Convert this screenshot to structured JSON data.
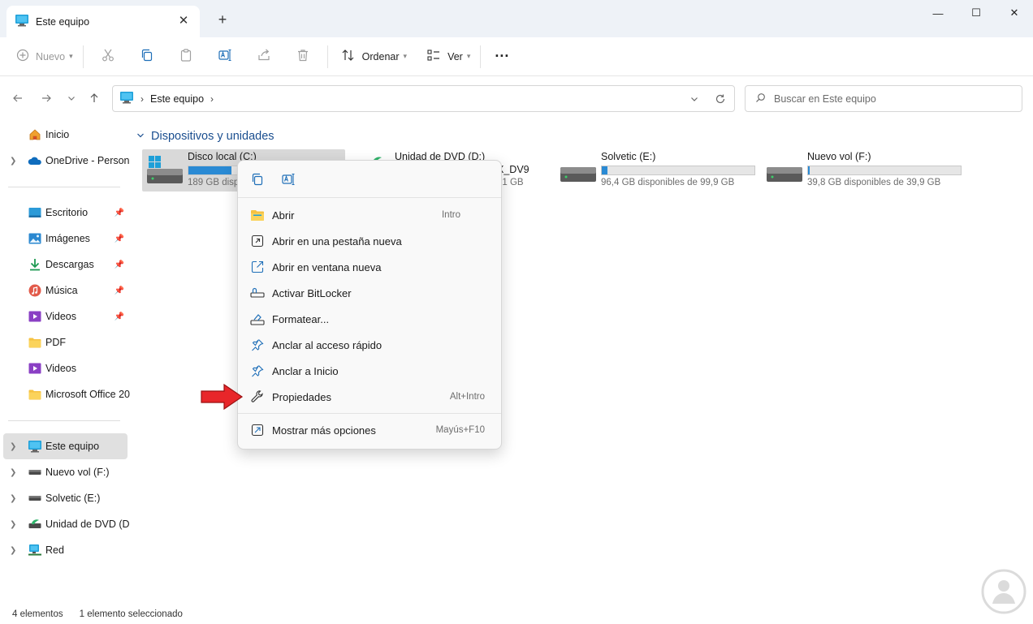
{
  "window": {
    "tab_title": "Este equipo",
    "tab_close": "✕",
    "new_tab": "+",
    "minimize": "—",
    "maximize": "☐",
    "close": "✕"
  },
  "toolbar": {
    "new_label": "Nuevo",
    "sort_label": "Ordenar",
    "view_label": "Ver",
    "more": "···",
    "icons": [
      "cut-icon",
      "copy-icon",
      "paste-icon",
      "rename-icon",
      "share-icon",
      "delete-icon"
    ]
  },
  "address": {
    "location": "Este equipo",
    "separator": "›",
    "search_placeholder": "Buscar en Este equipo"
  },
  "sidebar": {
    "items": [
      {
        "label": "Inicio",
        "icon": "home-icon"
      },
      {
        "label": "OneDrive - Persona",
        "icon": "onedrive-icon"
      },
      {
        "label": "Escritorio",
        "icon": "desktop-icon"
      },
      {
        "label": "Imágenes",
        "icon": "pictures-icon"
      },
      {
        "label": "Descargas",
        "icon": "downloads-icon"
      },
      {
        "label": "Música",
        "icon": "music-icon"
      },
      {
        "label": "Videos",
        "icon": "videos-icon"
      },
      {
        "label": "PDF",
        "icon": "folder-icon"
      },
      {
        "label": "Videos",
        "icon": "videos-icon"
      },
      {
        "label": "Microsoft Office 20",
        "icon": "folder-icon"
      },
      {
        "label": "Este equipo",
        "icon": "pc-icon"
      },
      {
        "label": "Nuevo vol (F:)",
        "icon": "drive-icon"
      },
      {
        "label": "Solvetic (E:)",
        "icon": "drive-icon"
      },
      {
        "label": "Unidad de DVD (D:)",
        "icon": "dvd-icon"
      },
      {
        "label": "Red",
        "icon": "network-icon"
      }
    ]
  },
  "main": {
    "group_title": "Dispositivos y unidades",
    "drives": [
      {
        "name": "Disco local (C:)",
        "space": "189 GB disp",
        "used_fraction": 0.28
      },
      {
        "name": "Unidad de DVD (D:)",
        "label_fragment": "X_DV9",
        "space": "91 GB"
      },
      {
        "name": "Solvetic (E:)",
        "space": "96,4 GB disponibles de 99,9 GB",
        "used_fraction": 0.035
      },
      {
        "name": "Nuevo vol (F:)",
        "space": "39,8 GB disponibles de 39,9 GB",
        "used_fraction": 0.003
      }
    ]
  },
  "context_menu": {
    "top_icons": [
      "copy-icon",
      "rename-icon"
    ],
    "items": [
      {
        "label": "Abrir",
        "shortcut": "Intro",
        "icon": "open-folder-icon"
      },
      {
        "label": "Abrir en una pestaña nueva",
        "shortcut": "",
        "icon": "new-tab-icon"
      },
      {
        "label": "Abrir en ventana nueva",
        "shortcut": "",
        "icon": "new-window-icon"
      },
      {
        "label": "Activar BitLocker",
        "shortcut": "",
        "icon": "bitlocker-icon"
      },
      {
        "label": "Formatear...",
        "shortcut": "",
        "icon": "format-icon"
      },
      {
        "label": "Anclar al acceso rápido",
        "shortcut": "",
        "icon": "pin-icon"
      },
      {
        "label": "Anclar a Inicio",
        "shortcut": "",
        "icon": "pin-icon"
      },
      {
        "label": "Propiedades",
        "shortcut": "Alt+Intro",
        "icon": "wrench-icon"
      }
    ],
    "more_options": {
      "label": "Mostrar más opciones",
      "shortcut": "Mayús+F10",
      "icon": "more-options-icon"
    }
  },
  "status": {
    "count": "4 elementos",
    "selected": "1 elemento seleccionado"
  },
  "colors": {
    "accent": "#2a8ad4",
    "group_header": "#1a4e8f",
    "arrow": "#e8262a"
  }
}
